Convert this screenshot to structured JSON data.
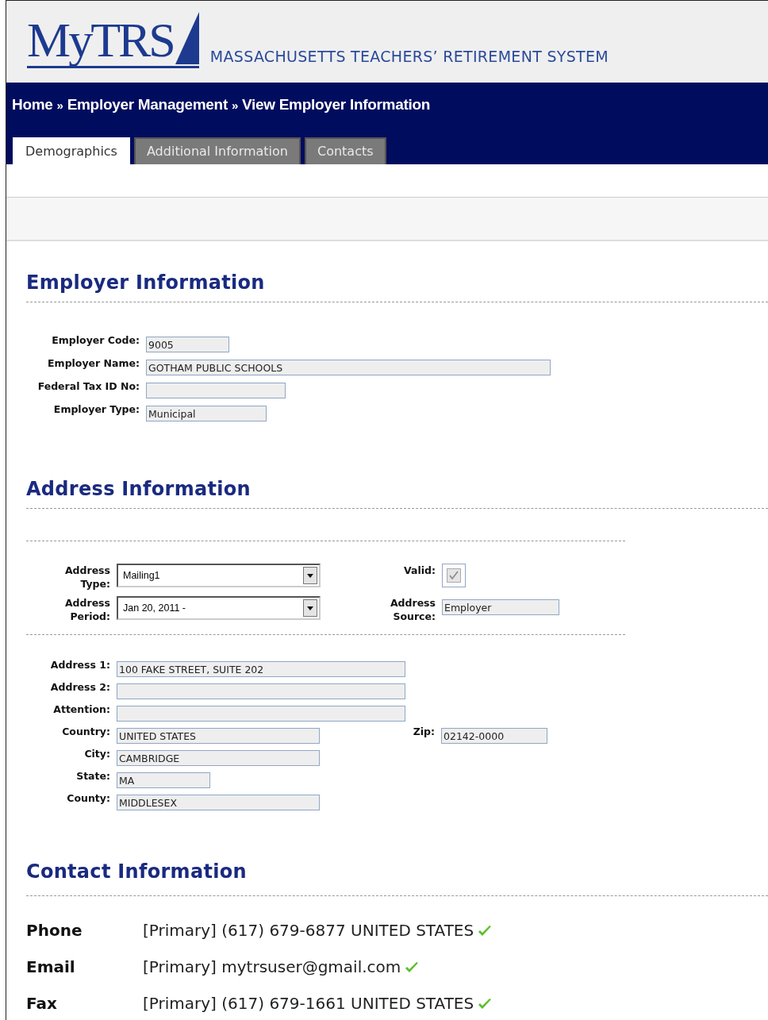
{
  "header": {
    "logo": "MyTRS",
    "title": "MASSACHUSETTS TEACHERS’ RETIREMENT SYSTEM"
  },
  "breadcrumb": {
    "separator": "»",
    "items": [
      "Home",
      "Employer Management",
      "View Employer Information"
    ]
  },
  "tabs": [
    {
      "label": "Demographics",
      "selected": true
    },
    {
      "label": "Additional Information",
      "selected": false
    },
    {
      "label": "Contacts",
      "selected": false
    }
  ],
  "employer_information": {
    "title": "Employer Information",
    "fields": [
      {
        "label": "Employer Code:",
        "value": "9005"
      },
      {
        "label": "Employer Name:",
        "value": "GOTHAM PUBLIC SCHOOLS"
      },
      {
        "label": "Federal Tax ID No:"
      },
      {
        "label": "Employer Type:",
        "value": "Municipal"
      }
    ]
  },
  "address_information": {
    "title": "Address Information",
    "address_type": {
      "label": "Address Type:",
      "value": "Mailing1"
    },
    "address_period": {
      "label": "Address Period:",
      "value": "Jan 20, 2011 -"
    },
    "valid": {
      "label": "Valid:",
      "checked": true,
      "disabled": true
    },
    "address_source": {
      "label": "Address Source:",
      "value": "Employer"
    },
    "fields": [
      {
        "label": "Address 1:",
        "value": "100 FAKE STREET, SUITE 202"
      },
      {
        "label": "Address 2:"
      },
      {
        "label": "Attention:"
      },
      {
        "label": "Country:",
        "value": "UNITED STATES"
      },
      {
        "label": "City:",
        "value": "CAMBRIDGE"
      },
      {
        "label": "State:",
        "value": "MA"
      },
      {
        "label": "County:",
        "value": "MIDDLESEX"
      }
    ],
    "zip": {
      "label": "Zip:",
      "value": "02142-0000"
    }
  },
  "contact_information": {
    "title": "Contact Information",
    "rows": [
      {
        "label": "Phone",
        "value": "[Primary] (617) 679-6877 UNITED STATES",
        "verified": true
      },
      {
        "label": "Email",
        "value": "[Primary] mytrsuser@gmail.com",
        "verified": true
      },
      {
        "label": "Fax",
        "value": "[Primary] (617) 679-1661 UNITED STATES",
        "verified": true
      }
    ]
  }
}
